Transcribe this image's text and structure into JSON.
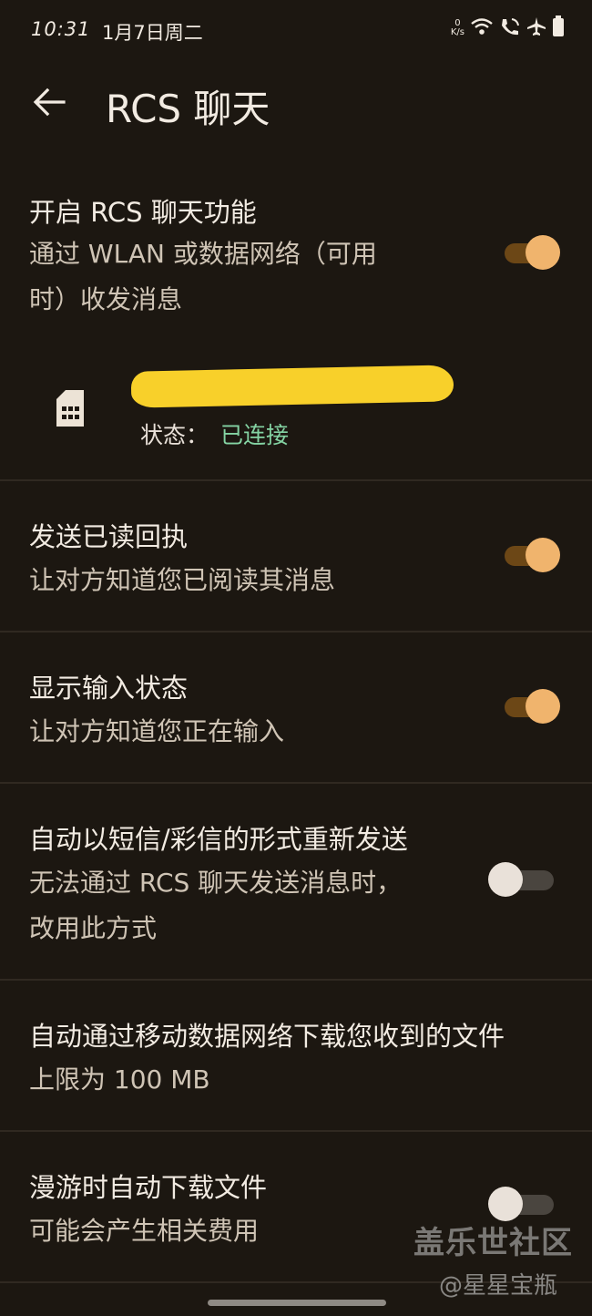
{
  "status_bar": {
    "time": "10:31",
    "date": "1月7日周二",
    "net_speed_value": "0",
    "net_speed_unit": "K/s"
  },
  "app_bar": {
    "back_icon": "arrow-back-icon",
    "title": "RCS 聊天"
  },
  "settings": {
    "enable_rcs": {
      "title": "开启 RCS 聊天功能",
      "subtitle_line1": "通过 WLAN 或数据网络（可用",
      "subtitle_line2": "时）收发消息",
      "enabled": true
    },
    "sim": {
      "icon": "sim-card-icon",
      "status_label": "状态：",
      "status_value": "已连接",
      "status_color": "#84d3a3"
    },
    "read_receipts": {
      "title": "发送已读回执",
      "subtitle": "让对方知道您已阅读其消息",
      "enabled": true
    },
    "typing_indicator": {
      "title": "显示输入状态",
      "subtitle": "让对方知道您正在输入",
      "enabled": true
    },
    "auto_resend_sms": {
      "title": "自动以短信/彩信的形式重新发送",
      "subtitle_line1": "无法通过 RCS 聊天发送消息时，",
      "subtitle_line2": "改用此方式",
      "enabled": false
    },
    "auto_download_mobile": {
      "title": "自动通过移动数据网络下载您收到的文件",
      "subtitle": "上限为 100 MB"
    },
    "auto_download_roaming": {
      "title": "漫游时自动下载文件",
      "subtitle": "可能会产生相关费用",
      "enabled": false
    }
  },
  "watermark": {
    "main": "盖乐世社区",
    "sub": "@星星宝瓶"
  },
  "colors": {
    "background": "#1c1711",
    "accent": "#f0b46d",
    "accent_track": "#6c4716",
    "redaction": "#f8d02a"
  }
}
